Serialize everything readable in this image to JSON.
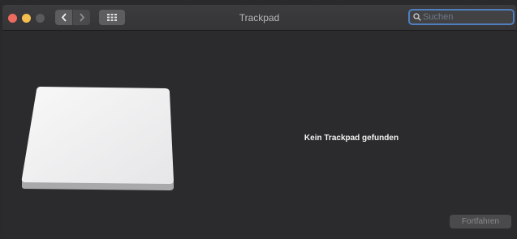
{
  "window": {
    "title": "Trackpad"
  },
  "toolbar": {
    "back_icon": "chevron-left-icon",
    "forward_icon": "chevron-right-icon",
    "grid_icon": "grid-icon"
  },
  "search": {
    "placeholder": "Suchen",
    "value": ""
  },
  "main": {
    "message": "Kein Trackpad gefunden",
    "continue_label": "Fortfahren"
  },
  "colors": {
    "close": "#ed6a5e",
    "minimize": "#f5bf4f",
    "search_focus": "#4f7fbf"
  }
}
